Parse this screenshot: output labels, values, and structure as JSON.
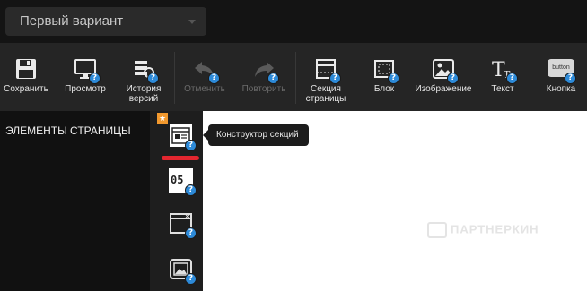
{
  "header": {
    "variant_label": "Первый вариант"
  },
  "toolbar": {
    "items": [
      {
        "label": "Сохранить",
        "icon": "save-icon",
        "enabled": true
      },
      {
        "label": "Просмотр",
        "icon": "monitor-icon",
        "enabled": true
      },
      {
        "label": "История\nверсий",
        "icon": "history-icon",
        "enabled": true
      },
      {
        "label": "Отменить",
        "icon": "undo-icon",
        "enabled": false
      },
      {
        "label": "Повторить",
        "icon": "redo-icon",
        "enabled": false
      },
      {
        "label": "Секция\nстраницы",
        "icon": "section-icon",
        "enabled": true
      },
      {
        "label": "Блок",
        "icon": "block-icon",
        "enabled": true
      },
      {
        "label": "Изображение",
        "icon": "image-icon",
        "enabled": true
      },
      {
        "label": "Текст",
        "icon": "text-icon",
        "enabled": true
      },
      {
        "label": "Кнопка",
        "icon": "button-icon",
        "enabled": true
      }
    ],
    "button_icon_text": "button",
    "help_badge": "?"
  },
  "elements_panel": {
    "title": "ЭЛЕМЕНТЫ СТРАНИЦЫ"
  },
  "sidebar_strip": {
    "items": [
      {
        "icon": "section-builder-icon",
        "active": true
      },
      {
        "icon": "counter-icon",
        "text": "05"
      },
      {
        "icon": "popup-window-icon"
      },
      {
        "icon": "gallery-icon"
      }
    ]
  },
  "tooltip": {
    "text": "Конструктор секций"
  },
  "watermark": {
    "text": "ПАРТНЕРКИН"
  },
  "colors": {
    "accent_blue": "#2d8ad8",
    "active_red": "#e3262f",
    "star_orange": "#f2992e",
    "toolbar_bg": "#252525"
  }
}
